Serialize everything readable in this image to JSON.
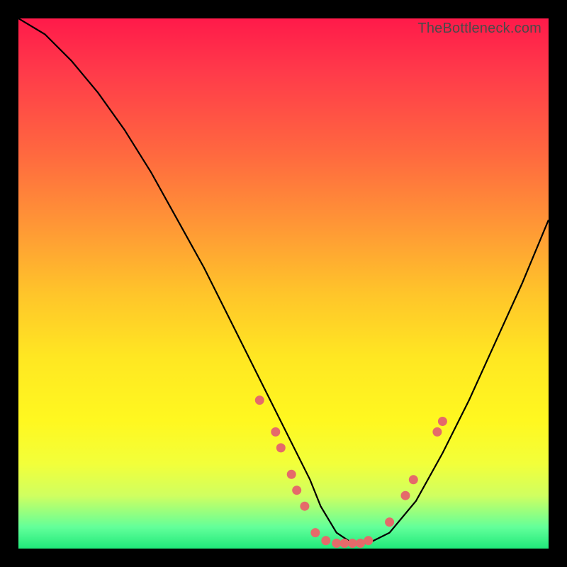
{
  "watermark": "TheBottleneck.com",
  "chart_data": {
    "type": "line",
    "title": "",
    "xlabel": "",
    "ylabel": "",
    "xlim": [
      0,
      100
    ],
    "ylim": [
      0,
      100
    ],
    "series": [
      {
        "name": "bottleneck-curve",
        "x": [
          0,
          5,
          10,
          15,
          20,
          25,
          30,
          35,
          40,
          45,
          50,
          55,
          57,
          60,
          63,
          66,
          70,
          75,
          80,
          85,
          90,
          95,
          100
        ],
        "y": [
          100,
          97,
          92,
          86,
          79,
          71,
          62,
          53,
          43,
          33,
          23,
          13,
          8,
          3,
          1,
          1,
          3,
          9,
          18,
          28,
          39,
          50,
          62
        ]
      }
    ],
    "markers": [
      {
        "x": 45.5,
        "y": 28
      },
      {
        "x": 48.5,
        "y": 22
      },
      {
        "x": 49.5,
        "y": 19
      },
      {
        "x": 51.5,
        "y": 14
      },
      {
        "x": 52.5,
        "y": 11
      },
      {
        "x": 54,
        "y": 8
      },
      {
        "x": 56,
        "y": 3
      },
      {
        "x": 58,
        "y": 1.5
      },
      {
        "x": 60,
        "y": 1
      },
      {
        "x": 61.5,
        "y": 1
      },
      {
        "x": 63,
        "y": 1
      },
      {
        "x": 64.5,
        "y": 1
      },
      {
        "x": 66,
        "y": 1.5
      },
      {
        "x": 70,
        "y": 5
      },
      {
        "x": 73,
        "y": 10
      },
      {
        "x": 74.5,
        "y": 13
      },
      {
        "x": 79,
        "y": 22
      },
      {
        "x": 80,
        "y": 24
      }
    ],
    "marker_color": "#e56a6a",
    "curve_color": "#000000"
  }
}
